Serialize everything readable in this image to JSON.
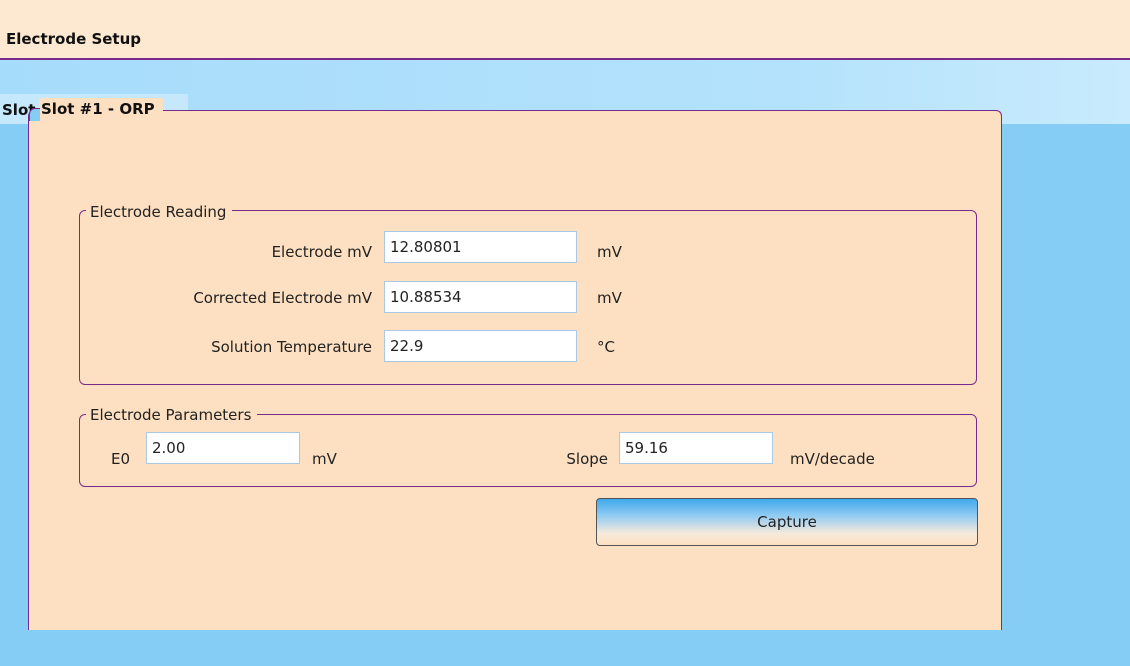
{
  "window": {
    "title": "Electrode Setup"
  },
  "tabs": [
    {
      "label": "Slot #1 - ORP"
    }
  ],
  "panel": {
    "title": "Slot #1 - ORP",
    "reading": {
      "title": "Electrode Reading",
      "rows": [
        {
          "label": "Electrode mV",
          "value": "12.80801",
          "unit": "mV"
        },
        {
          "label": "Corrected Electrode mV",
          "value": "10.88534",
          "unit": "mV"
        },
        {
          "label": "Solution Temperature",
          "value": "22.9",
          "unit": "°C"
        }
      ]
    },
    "parameters": {
      "title": "Electrode Parameters",
      "e0": {
        "label": "E0",
        "value": "2.00",
        "unit": "mV"
      },
      "slope": {
        "label": "Slope",
        "value": "59.16",
        "unit": "mV/decade"
      }
    },
    "capture_label": "Capture"
  }
}
